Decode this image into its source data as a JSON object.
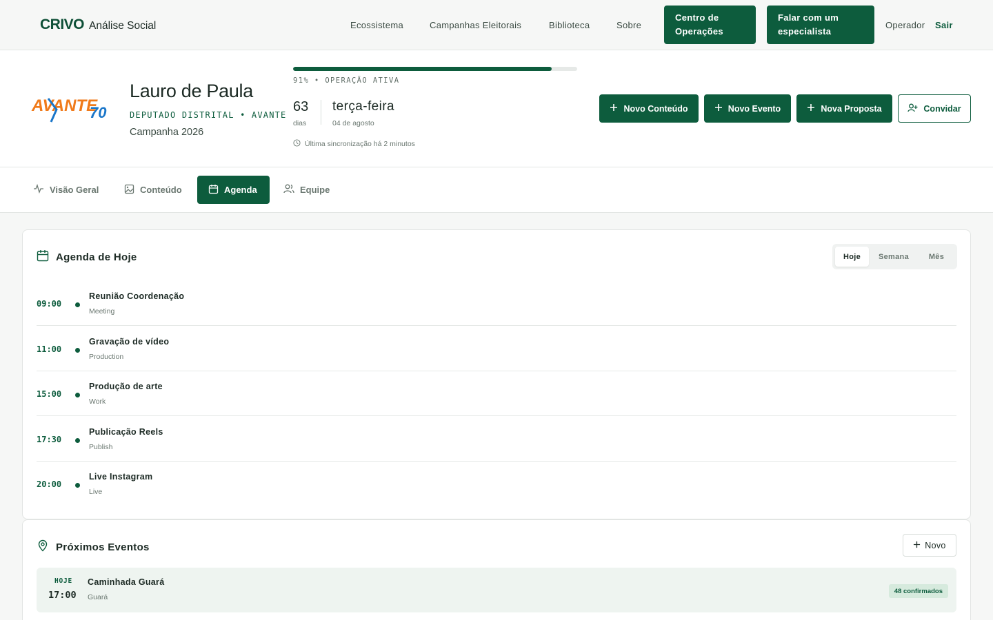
{
  "nav": {
    "brand": "CRIVO",
    "brand_sub": "Análise Social",
    "links": [
      "Ecossistema",
      "Campanhas Eleitorais",
      "Biblioteca",
      "Sobre"
    ],
    "btn_ops": "Centro de Operações",
    "btn_expert": "Falar com um especialista",
    "user": "Operador",
    "logout": "Sair"
  },
  "candidate": {
    "logo_text": "AVANTE",
    "logo_number": "70",
    "name": "Lauro de Paula",
    "role": "DEPUTADO DISTRITAL • AVANTE",
    "campaign": "Campanha 2026"
  },
  "status": {
    "progress": 0.91,
    "progress_label": "91% • OPERAÇÃO ATIVA",
    "days": "63",
    "days_label": "dias",
    "weekday": "terça-feira",
    "date": "04 de agosto",
    "sync": "Última sincronização há 2 minutos"
  },
  "actions": {
    "new_content": "Novo Conteúdo",
    "new_event": "Novo Evento",
    "new_proposal": "Nova Proposta",
    "invite": "Convidar"
  },
  "tabs": [
    "Visão Geral",
    "Conteúdo",
    "Agenda",
    "Equipe"
  ],
  "agenda": {
    "title": "Agenda de Hoje",
    "filters": [
      "Hoje",
      "Semana",
      "Mês"
    ],
    "items": [
      {
        "time": "09:00",
        "title": "Reunião Coordenação",
        "type": "Meeting"
      },
      {
        "time": "11:00",
        "title": "Gravação de vídeo",
        "type": "Production"
      },
      {
        "time": "15:00",
        "title": "Produção de arte",
        "type": "Work"
      },
      {
        "time": "17:30",
        "title": "Publicação Reels",
        "type": "Publish"
      },
      {
        "time": "20:00",
        "title": "Live Instagram",
        "type": "Live"
      }
    ]
  },
  "events": {
    "title": "Próximos Eventos",
    "new_label": "Novo",
    "items": [
      {
        "day": "HOJE",
        "time": "17:00",
        "title": "Caminhada Guará",
        "location": "Guará",
        "badge": "48 confirmados"
      }
    ]
  },
  "colors": {
    "accent": "#0d5c3d",
    "logo_orange": "#f07a1a",
    "logo_blue": "#1a76c9"
  }
}
